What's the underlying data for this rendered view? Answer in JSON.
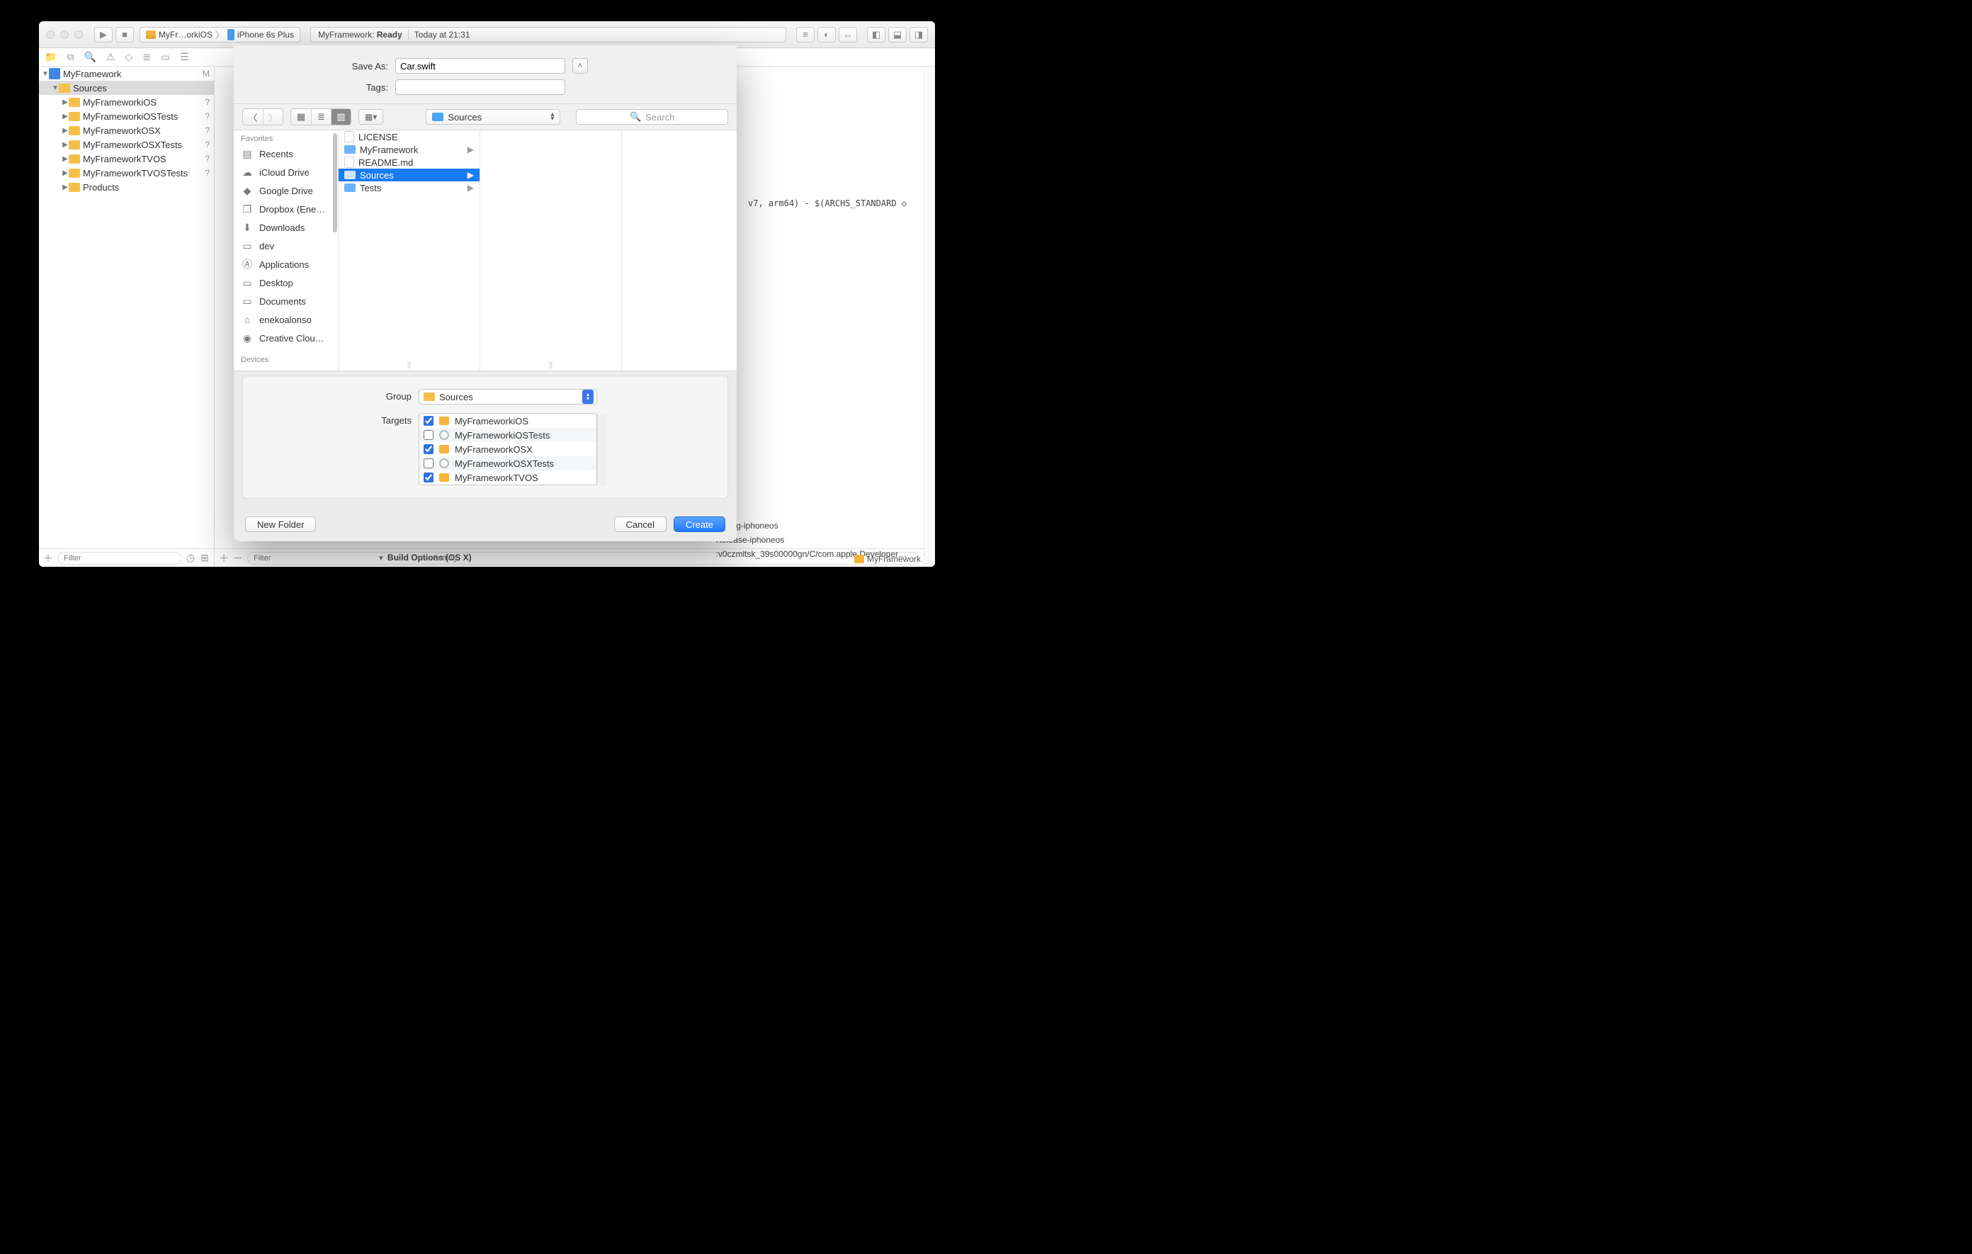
{
  "toolbar": {
    "scheme_target": "MyFr…orkiOS",
    "scheme_device": "iPhone 6s Plus",
    "activity_prefix": "MyFramework: ",
    "activity_status": "Ready",
    "activity_time": "Today at 21:31"
  },
  "navigator": {
    "project": {
      "name": "MyFramework",
      "status": "M"
    },
    "selected": "Sources",
    "items": [
      {
        "name": "Sources",
        "status": ""
      },
      {
        "name": "MyFrameworkiOS",
        "status": "?"
      },
      {
        "name": "MyFrameworkiOSTests",
        "status": "?"
      },
      {
        "name": "MyFrameworkOSX",
        "status": "?"
      },
      {
        "name": "MyFrameworkOSXTests",
        "status": "?"
      },
      {
        "name": "MyFrameworkTVOS",
        "status": "?"
      },
      {
        "name": "MyFrameworkTVOSTests",
        "status": "?"
      },
      {
        "name": "Products",
        "status": ""
      }
    ],
    "filter_placeholder": "Filter"
  },
  "editor": {
    "archs_text": "v7, arm64) - $(ARCHS_STANDARD ◇",
    "paths": [
      "Debug-iphoneos",
      "Release-iphoneos",
      ":v0czmltsk_39s00000gn/C/com.apple.Developer…"
    ],
    "section": "Build Options (OS X)",
    "setting_label": "Setting",
    "right_label": "MyFramework",
    "filter_placeholder": "Filter"
  },
  "sheet": {
    "save_as_label": "Save As:",
    "save_as_value": "Car.swift",
    "tags_label": "Tags:",
    "tags_value": "",
    "path_popup": "Sources",
    "search_placeholder": "Search",
    "favorites_header": "Favorites",
    "favorites": [
      "Recents",
      "iCloud Drive",
      "Google Drive",
      "Dropbox (Ene…",
      "Downloads",
      "dev",
      "Applications",
      "Desktop",
      "Documents",
      "enekoalonso",
      "Creative Clou…"
    ],
    "devices_header": "Devices",
    "column1": [
      {
        "name": "LICENSE",
        "type": "file"
      },
      {
        "name": "MyFramework",
        "type": "folder"
      },
      {
        "name": "README.md",
        "type": "file"
      },
      {
        "name": "Sources",
        "type": "folder",
        "selected": true
      },
      {
        "name": "Tests",
        "type": "folder"
      }
    ],
    "group_label": "Group",
    "group_value": "Sources",
    "targets_label": "Targets",
    "targets": [
      {
        "name": "MyFrameworkiOS",
        "checked": true,
        "kind": "framework"
      },
      {
        "name": "MyFrameworkiOSTests",
        "checked": false,
        "kind": "test"
      },
      {
        "name": "MyFrameworkOSX",
        "checked": true,
        "kind": "framework"
      },
      {
        "name": "MyFrameworkOSXTests",
        "checked": false,
        "kind": "test"
      },
      {
        "name": "MyFrameworkTVOS",
        "checked": true,
        "kind": "framework"
      }
    ],
    "new_folder": "New Folder",
    "cancel": "Cancel",
    "create": "Create"
  }
}
